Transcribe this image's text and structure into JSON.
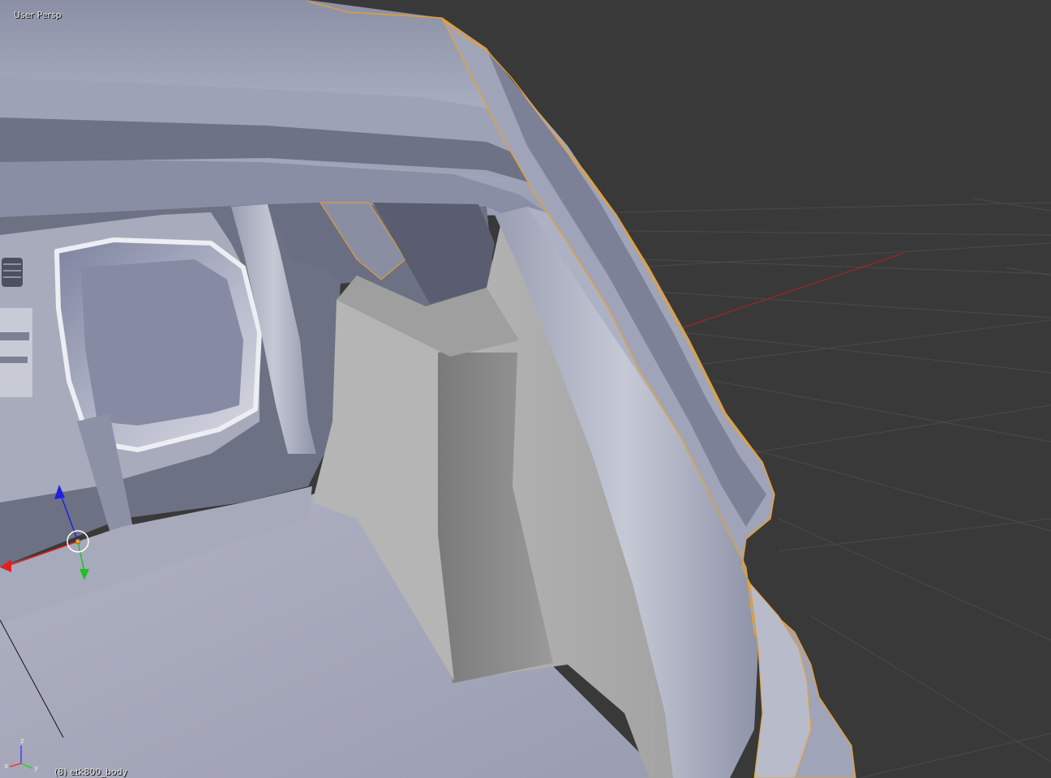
{
  "viewport": {
    "view_name": "User Persp",
    "object_info": "(8) etk800_body"
  },
  "axis_widget": {
    "z_label": "z",
    "x_label": "x",
    "y_label": "y"
  },
  "colors": {
    "background": "#393939",
    "grid": "#4a4a4a",
    "x_axis": "#8c2b2b",
    "selection_outline": "#f0a020",
    "mesh_light": "#b8bccb",
    "mesh_dark": "#6e7285",
    "gizmo_x": "#e02020",
    "gizmo_y": "#20c020",
    "gizmo_z": "#2020e0"
  }
}
